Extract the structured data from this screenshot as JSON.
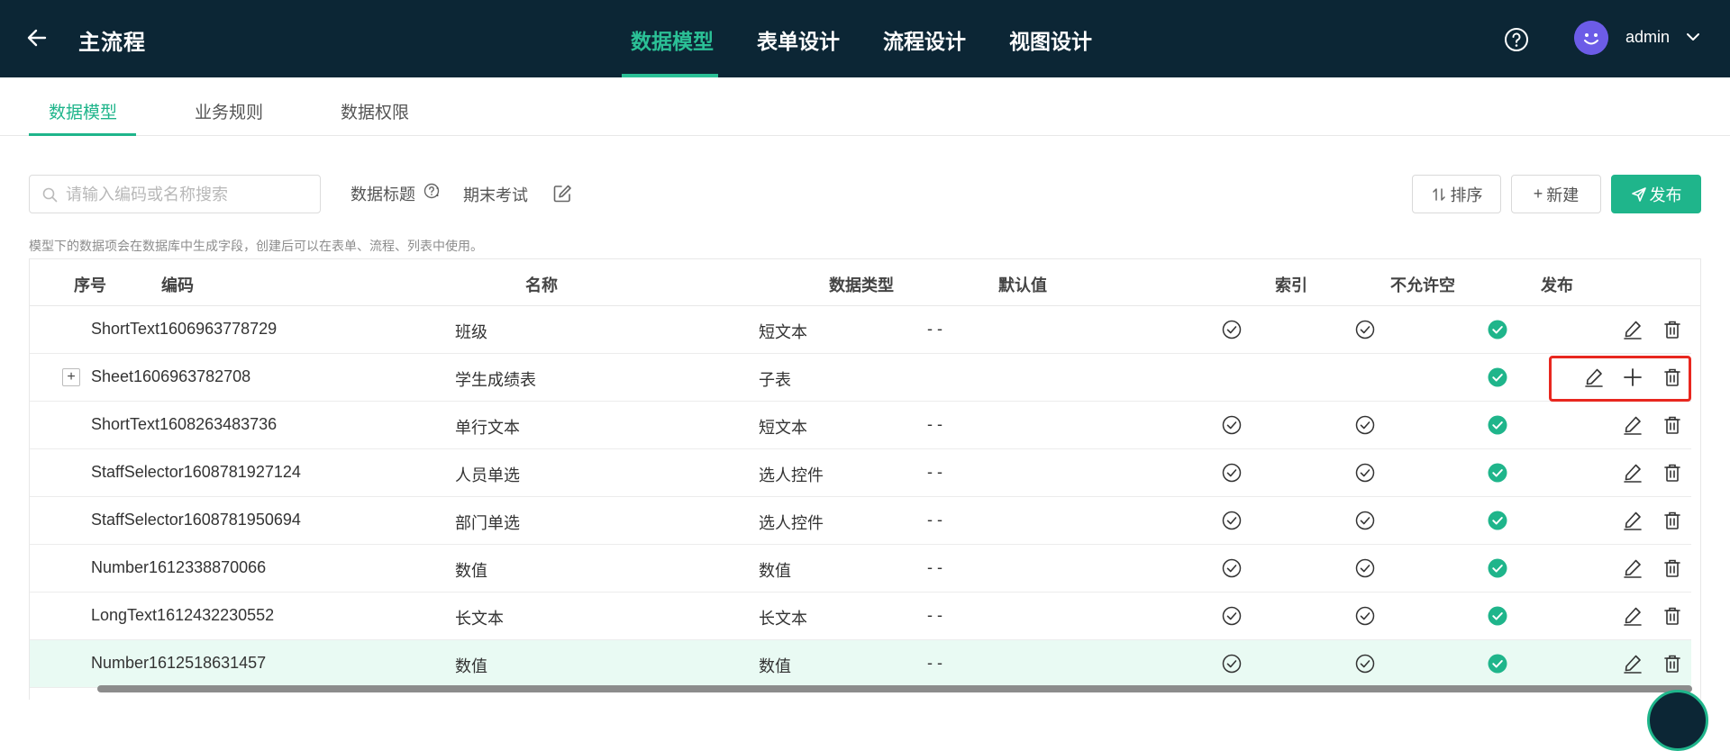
{
  "header": {
    "title": "主流程",
    "tabs": [
      {
        "label": "数据模型",
        "active": true
      },
      {
        "label": "表单设计",
        "active": false
      },
      {
        "label": "流程设计",
        "active": false
      },
      {
        "label": "视图设计",
        "active": false
      }
    ],
    "user": "admin",
    "colors": {
      "bg": "#0c2635",
      "accent": "#2bc096",
      "avatar": "#6c5ce7"
    }
  },
  "subtabs": [
    {
      "label": "数据模型",
      "active": true
    },
    {
      "label": "业务规则",
      "active": false
    },
    {
      "label": "数据权限",
      "active": false
    }
  ],
  "toolbar": {
    "search_placeholder": "请输入编码或名称搜索",
    "data_title_label": "数据标题",
    "colon": ":",
    "data_title_value": "期末考试",
    "sort_label": "排序",
    "new_label": "新建",
    "publish_label": "发布"
  },
  "hint": "模型下的数据项会在数据库中生成字段，创建后可以在表单、流程、列表中使用。",
  "table": {
    "columns": [
      "序号",
      "编码",
      "名称",
      "数据类型",
      "默认值",
      "索引",
      "不允许空",
      "发布"
    ],
    "rows": [
      {
        "code": "ShortText1606963778729",
        "name": "班级",
        "type": "短文本",
        "default": "- -",
        "index": true,
        "not_null": true,
        "published": true,
        "expandable": false,
        "highlight": false,
        "selected": false
      },
      {
        "code": "Sheet1606963782708",
        "name": "学生成绩表",
        "type": "子表",
        "default": "",
        "index": false,
        "not_null": false,
        "published": true,
        "expandable": true,
        "highlight": false,
        "selected": true
      },
      {
        "code": "ShortText1608263483736",
        "name": "单行文本",
        "type": "短文本",
        "default": "- -",
        "index": true,
        "not_null": true,
        "published": true,
        "expandable": false,
        "highlight": false,
        "selected": false
      },
      {
        "code": "StaffSelector1608781927124",
        "name": "人员单选",
        "type": "选人控件",
        "default": "- -",
        "index": true,
        "not_null": true,
        "published": true,
        "expandable": false,
        "highlight": false,
        "selected": false
      },
      {
        "code": "StaffSelector1608781950694",
        "name": "部门单选",
        "type": "选人控件",
        "default": "- -",
        "index": true,
        "not_null": true,
        "published": true,
        "expandable": false,
        "highlight": false,
        "selected": false
      },
      {
        "code": "Number1612338870066",
        "name": "数值",
        "type": "数值",
        "default": "- -",
        "index": true,
        "not_null": true,
        "published": true,
        "expandable": false,
        "highlight": false,
        "selected": false
      },
      {
        "code": "LongText1612432230552",
        "name": "长文本",
        "type": "长文本",
        "default": "- -",
        "index": true,
        "not_null": true,
        "published": true,
        "expandable": false,
        "highlight": false,
        "selected": false
      },
      {
        "code": "Number1612518631457",
        "name": "数值",
        "type": "数值",
        "default": "- -",
        "index": true,
        "not_null": true,
        "published": true,
        "expandable": false,
        "highlight": true,
        "selected": false
      }
    ]
  },
  "colors": {
    "primary": "#1fb58b",
    "highlight_row": "#e9faf3",
    "selection_border": "#e8271f"
  }
}
